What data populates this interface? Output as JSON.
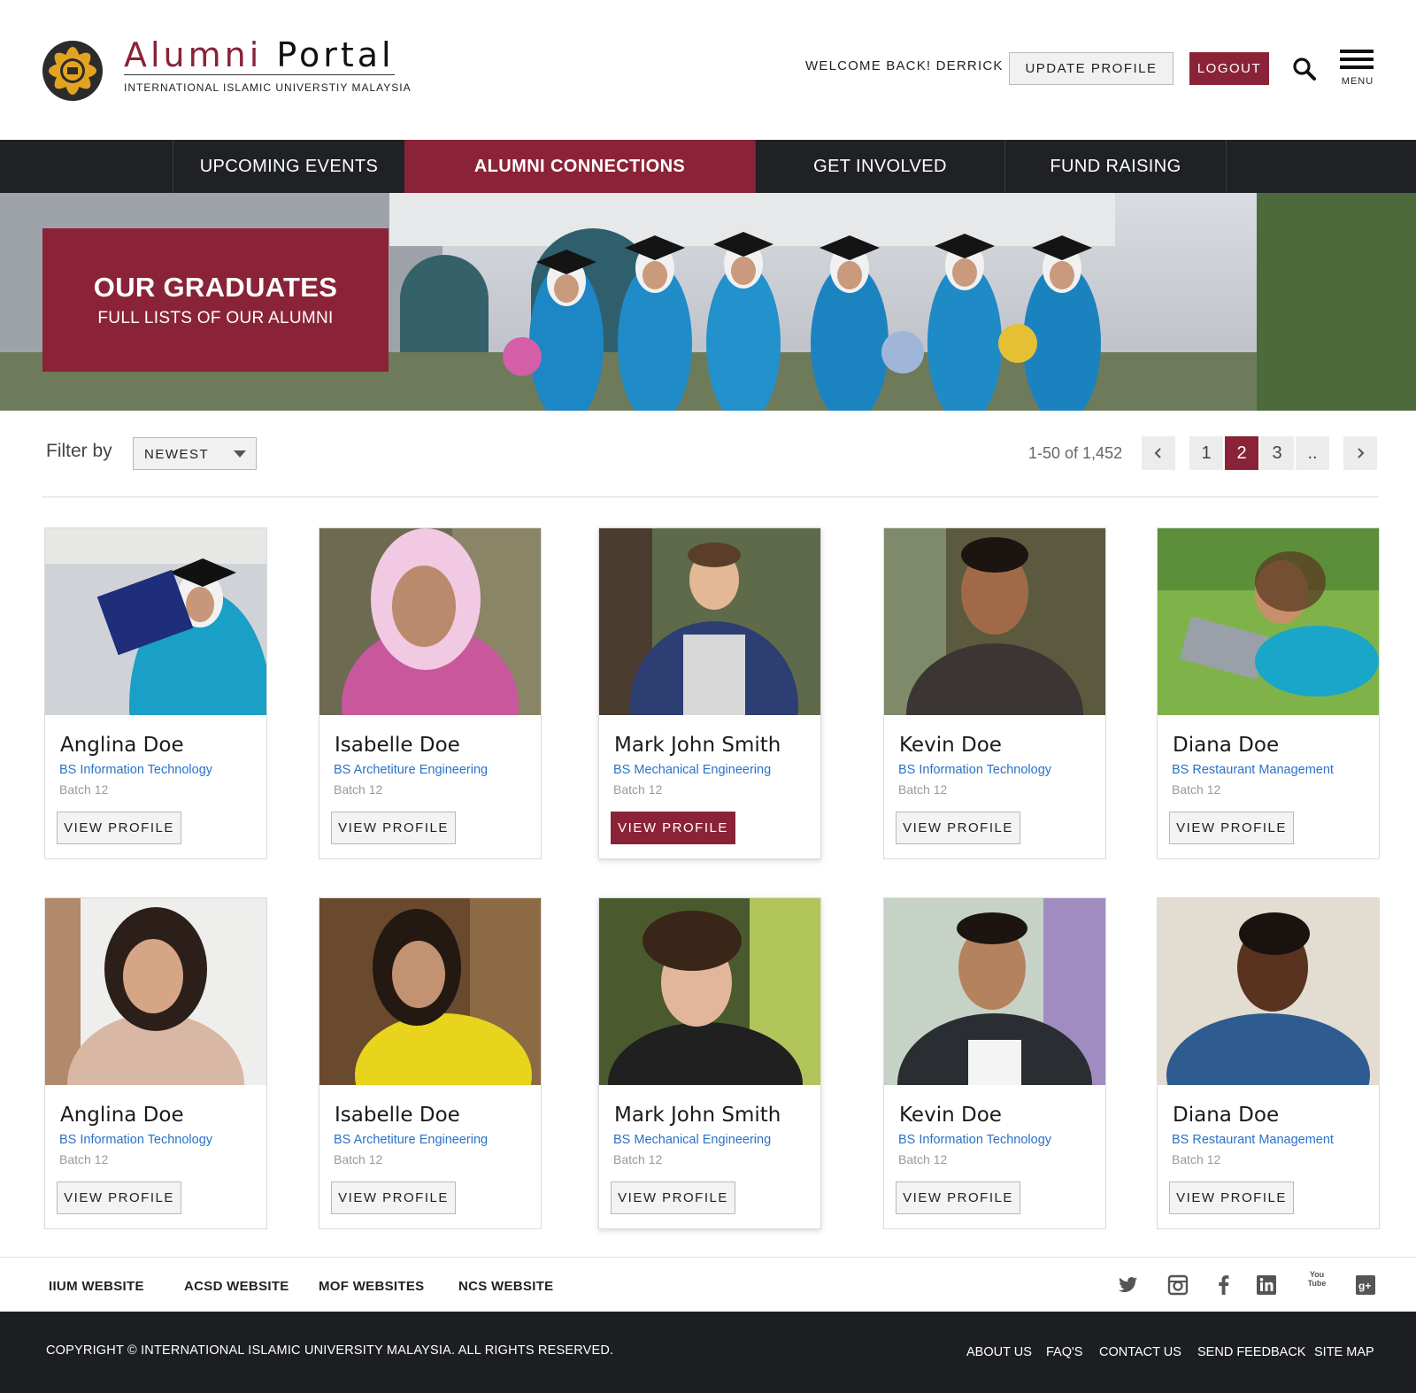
{
  "header": {
    "logo_word1": "Alumni",
    "logo_word2": "Portal",
    "logo_subtitle": "INTERNATIONAL ISLAMIC UNIVERSTIY MALAYSIA",
    "welcome": "WELCOME BACK! DERRICK",
    "update_profile": "UPDATE PROFILE",
    "logout": "LOGOUT",
    "menu_label": "MENU"
  },
  "nav": {
    "items": [
      {
        "label": "UPCOMING EVENTS"
      },
      {
        "label": "ALUMNI CONNECTIONS",
        "active": true
      },
      {
        "label": "GET INVOLVED"
      },
      {
        "label": "FUND RAISING"
      }
    ]
  },
  "hero": {
    "title": "OUR GRADUATES",
    "subtitle": "FULL LISTS OF OUR ALUMNI"
  },
  "filter": {
    "label": "Filter by",
    "selected": "NEWEST"
  },
  "pagination": {
    "range": "1-50 of 1,452",
    "pages": [
      "1",
      "2",
      "3",
      ".."
    ],
    "current": "2"
  },
  "alumni": [
    {
      "name": "Anglina Doe",
      "course": "BS Information Technology",
      "batch": "Batch 12",
      "button": "VIEW PROFILE"
    },
    {
      "name": "Isabelle Doe",
      "course": "BS Archetiture Engineering",
      "batch": "Batch 12",
      "button": "VIEW PROFILE"
    },
    {
      "name": "Mark John Smith",
      "course": "BS Mechanical Engineering",
      "batch": "Batch 12",
      "button": "VIEW PROFILE",
      "active": true
    },
    {
      "name": "Kevin Doe",
      "course": "BS Information Technology",
      "batch": "Batch 12",
      "button": "VIEW PROFILE"
    },
    {
      "name": "Diana Doe",
      "course": "BS Restaurant Management",
      "batch": "Batch 12",
      "button": "VIEW PROFILE"
    },
    {
      "name": "Anglina Doe",
      "course": "BS Information Technology",
      "batch": "Batch 12",
      "button": "VIEW PROFILE"
    },
    {
      "name": "Isabelle Doe",
      "course": "BS Archetiture Engineering",
      "batch": "Batch 12",
      "button": "VIEW PROFILE"
    },
    {
      "name": "Mark John Smith",
      "course": "BS Mechanical Engineering",
      "batch": "Batch 12",
      "button": "VIEW PROFILE"
    },
    {
      "name": "Kevin Doe",
      "course": "BS Information Technology",
      "batch": "Batch 12",
      "button": "VIEW PROFILE"
    },
    {
      "name": "Diana Doe",
      "course": "BS Restaurant Management",
      "batch": "Batch 12",
      "button": "VIEW PROFILE"
    }
  ],
  "footer": {
    "links": [
      "IIUM WEBSITE",
      "ACSD WEBSITE",
      "MOF WEBSITES",
      "NCS WEBSITE"
    ],
    "social": [
      "twitter-icon",
      "instagram-icon",
      "facebook-icon",
      "linkedin-icon",
      "youtube-icon",
      "google-plus-icon"
    ],
    "youtube_text": "You Tube",
    "copyright": "COPYRIGHT © INTERNATIONAL ISLAMIC UNIVERSITY MALAYSIA. ALL RIGHTS RESERVED.",
    "bottom_links": [
      "ABOUT US",
      "FAQ'S",
      "CONTACT US",
      "SEND FEEDBACK",
      "SITE MAP"
    ]
  },
  "colors": {
    "accent": "#8a2338",
    "nav_bg": "#1f2124",
    "link_blue": "#2a72c8"
  }
}
